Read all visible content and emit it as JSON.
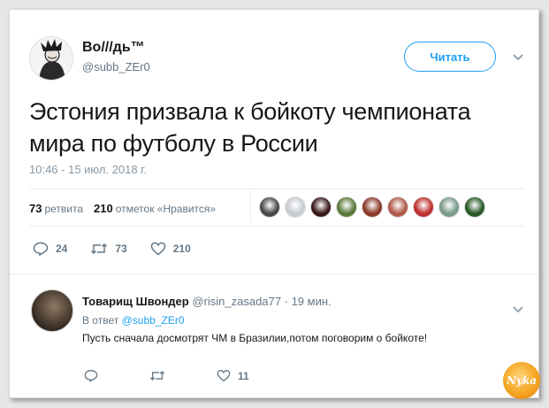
{
  "tweet": {
    "author_name": "Во///дь™",
    "author_handle": "@subb_ZEr0",
    "follow_label": "Читать",
    "text": "Эстония призвала к бойкоту чемпионата мира по футболу в России",
    "timestamp": "10:46 - 15 июл. 2018 г.",
    "retweets_count": "73",
    "retweets_label": "ретвита",
    "likes_count": "210",
    "likes_label": "отметок «Нравится»",
    "liker_colors": [
      "#4a4a4a",
      "#c8ccd0",
      "#3a1a1a",
      "#5a7a3a",
      "#8a3a2a",
      "#b05a4a",
      "#c03030",
      "#7a9a8a",
      "#2a5a2a"
    ],
    "actions": {
      "replies": "24",
      "retweets": "73",
      "likes": "210"
    }
  },
  "reply": {
    "name": "Товарищ Швондер",
    "handle": "@risin_zasada77",
    "time": "· 19 мин.",
    "in_reply_prefix": "В ответ",
    "in_reply_handle": "@subb_ZEr0",
    "text": "Пусть сначала досмотрят ЧМ в Бразилии,потом поговорим о бойкоте!",
    "actions": {
      "likes": "11"
    }
  },
  "watermark": {
    "text": "Nyka"
  },
  "colors": {
    "accent": "#1da1f2",
    "muted": "#657786",
    "text": "#14171a"
  }
}
